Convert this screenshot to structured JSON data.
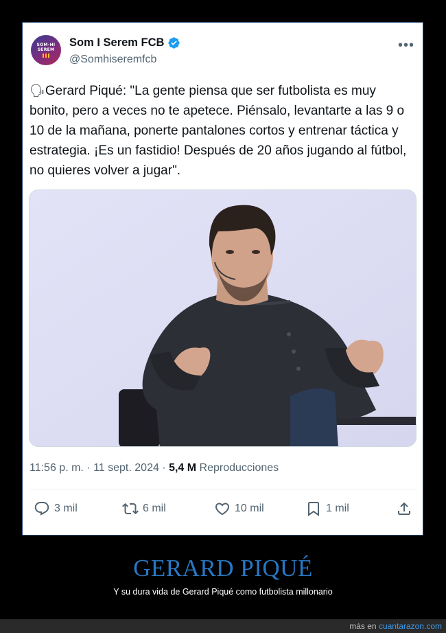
{
  "tweet": {
    "author": {
      "display_name": "Som I Serem FCB",
      "handle": "@Somhiseremfcb",
      "avatar_text": [
        "SOM-HI",
        "SEREM"
      ],
      "verified_icon": "verified-badge-icon"
    },
    "more_icon": "more-options-icon",
    "text_emoji": "🗣",
    "text": "Gerard Piqué: \"La gente piensa que ser futbolista es muy bonito, pero a veces no te apetece. Piénsalo, levantarte a las 9 o 10 de la mañana, ponerte pantalones cortos y entrenar táctica y estrategia. ¡Es un fastidio! Después de 20 años jugando al fútbol, no quieres volver a jugar\".",
    "meta": {
      "time": "11:56 p. m.",
      "sep1": " · ",
      "date": "11 sept. 2024",
      "sep2": " · ",
      "views_count": "5,4 M",
      "views_label": " Reproducciones"
    },
    "actions": {
      "replies": "3 mil",
      "reposts": "6 mil",
      "likes": "10 mil",
      "bookmarks": "1 mil"
    }
  },
  "caption": {
    "title": "GERARD PIQUÉ",
    "subtitle": "Y su dura vida de Gerard Piqué como futbolista millonario"
  },
  "footer": {
    "prefix": "más en ",
    "site": "cuantarazon.com"
  },
  "colors": {
    "caption_title": "#2778c4",
    "verified": "#1d9bf0",
    "photo_background": "#dfe0f5"
  }
}
